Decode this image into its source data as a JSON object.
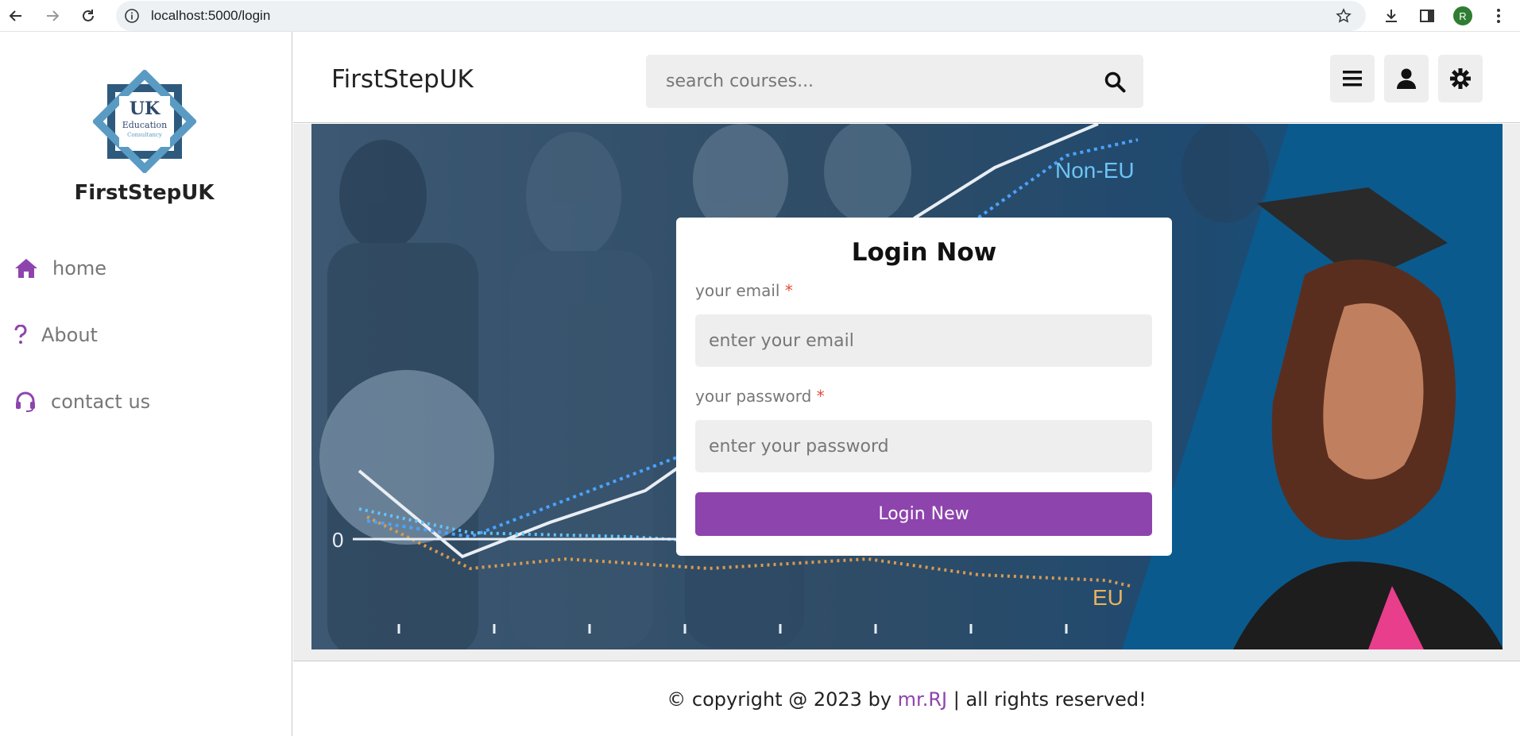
{
  "browser": {
    "url": "localhost:5000/login",
    "profile_initial": "R"
  },
  "sidebar": {
    "brand": "FirstStepUK",
    "logo": {
      "line1": "UK",
      "line2": "Education",
      "line3": "Consultancy"
    },
    "items": [
      {
        "label": "home",
        "icon": "home-icon"
      },
      {
        "label": "About",
        "icon": "question-icon"
      },
      {
        "label": "contact us",
        "icon": "headset-icon"
      }
    ]
  },
  "header": {
    "brand": "FirstStepUK",
    "search_placeholder": "search courses...",
    "buttons": [
      "menu-icon",
      "user-icon",
      "theme-toggle-icon"
    ]
  },
  "hero": {
    "label_noneu": "Non-EU",
    "label_eu": "EU",
    "label_zero": "0"
  },
  "login": {
    "title": "Login Now",
    "email_label": "your email",
    "email_placeholder": "enter your email",
    "password_label": "your password",
    "password_placeholder": "enter your password",
    "required_mark": "*",
    "button_label": "Login New"
  },
  "footer": {
    "prefix": "© copyright @ 2023 by ",
    "author": "mr.RJ",
    "suffix": " | all rights reserved!"
  },
  "colors": {
    "accent": "#8e44ad",
    "required": "#e74c3c"
  }
}
